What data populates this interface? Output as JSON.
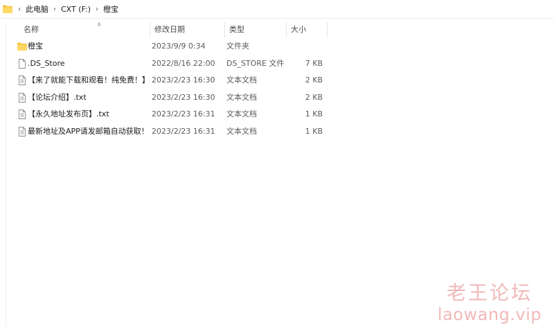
{
  "breadcrumb": {
    "items": [
      {
        "label": "此电脑"
      },
      {
        "label": "CXT (F:)"
      },
      {
        "label": "橙宝"
      }
    ]
  },
  "columns": {
    "name": "名称",
    "date": "修改日期",
    "type": "类型",
    "size": "大小",
    "sorted_by": "name"
  },
  "files": [
    {
      "name": "橙宝",
      "date": "2023/9/9 0:34",
      "type": "文件夹",
      "size": "",
      "icon": "folder-icon"
    },
    {
      "name": ".DS_Store",
      "date": "2022/8/16 22:00",
      "type": "DS_STORE 文件",
      "size": "7 KB",
      "icon": "file-icon"
    },
    {
      "name": "【来了就能下载和观看！纯免费！】.txt",
      "date": "2023/2/23 16:30",
      "type": "文本文档",
      "size": "2 KB",
      "icon": "text-file-icon"
    },
    {
      "name": "【论坛介绍】.txt",
      "date": "2023/2/23 16:30",
      "type": "文本文档",
      "size": "2 KB",
      "icon": "text-file-icon"
    },
    {
      "name": "【永久地址发布页】.txt",
      "date": "2023/2/23 16:31",
      "type": "文本文档",
      "size": "1 KB",
      "icon": "text-file-icon"
    },
    {
      "name": "最新地址及APP请发邮箱自动获取！！！...",
      "date": "2023/2/23 16:31",
      "type": "文本文档",
      "size": "1 KB",
      "icon": "text-file-icon"
    }
  ],
  "watermark": {
    "title": "老王论坛",
    "url": "laowang.vip"
  },
  "colors": {
    "folder": "#f4c542",
    "watermark": "#f2b8b8",
    "hover": "#e5f1fb"
  }
}
